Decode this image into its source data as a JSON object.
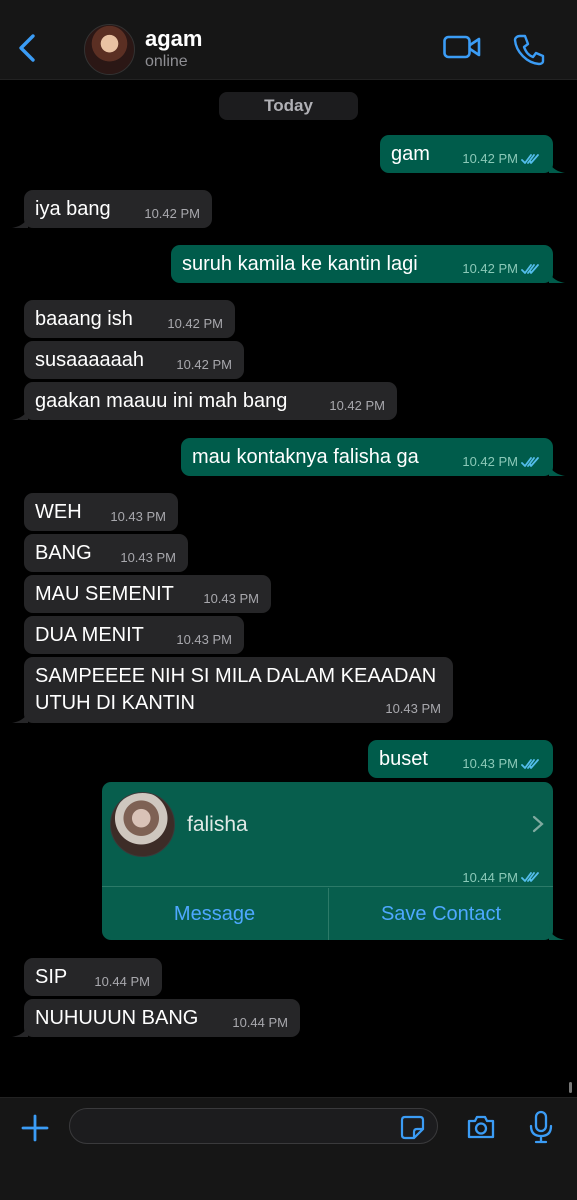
{
  "header": {
    "contact_name": "agam",
    "status": "online",
    "icons": [
      "chevron-left-icon",
      "video-camera-icon",
      "phone-icon"
    ]
  },
  "date_label": "Today",
  "messages": [
    {
      "dir": "out",
      "text": "gam",
      "time": "10.42 PM"
    },
    {
      "dir": "in",
      "text": "iya bang",
      "time": "10.42 PM"
    },
    {
      "dir": "out",
      "text": "suruh kamila ke kantin lagi",
      "time": "10.42 PM"
    },
    {
      "dir": "in",
      "text": "baaang ish",
      "time": "10.42 PM"
    },
    {
      "dir": "in",
      "text": "susaaaaaah",
      "time": "10.42 PM"
    },
    {
      "dir": "in",
      "text": "gaakan maauu ini mah bang",
      "time": "10.42 PM"
    },
    {
      "dir": "out",
      "text": "mau kontaknya falisha ga",
      "time": "10.42 PM"
    },
    {
      "dir": "in",
      "text": "WEH",
      "time": "10.43 PM"
    },
    {
      "dir": "in",
      "text": "BANG",
      "time": "10.43 PM"
    },
    {
      "dir": "in",
      "text": "MAU SEMENIT",
      "time": "10.43 PM"
    },
    {
      "dir": "in",
      "text": "DUA MENIT",
      "time": "10.43 PM"
    },
    {
      "dir": "in",
      "text": "SAMPEEEE NIH SI MILA DALAM KEAADAN",
      "text2": "UTUH DI KANTIN",
      "time": "10.43 PM"
    },
    {
      "dir": "out",
      "text": "buset",
      "time": "10.43 PM"
    },
    {
      "dir": "in",
      "text": "SIP",
      "time": "10.44 PM"
    },
    {
      "dir": "in",
      "text": "NUHUUUN BANG",
      "time": "10.44 PM"
    }
  ],
  "contact_card": {
    "name": "falisha",
    "time": "10.44 PM",
    "message_label": "Message",
    "save_label": "Save Contact"
  },
  "composer": {
    "placeholder": "",
    "icons": [
      "plus-icon",
      "sticker-icon",
      "camera-icon",
      "microphone-icon"
    ]
  },
  "colors": {
    "incoming_bubble": "#262628",
    "outgoing_bubble": "#005c4b",
    "accent": "#4ea8ff",
    "read_receipt": "#53bdeb"
  }
}
